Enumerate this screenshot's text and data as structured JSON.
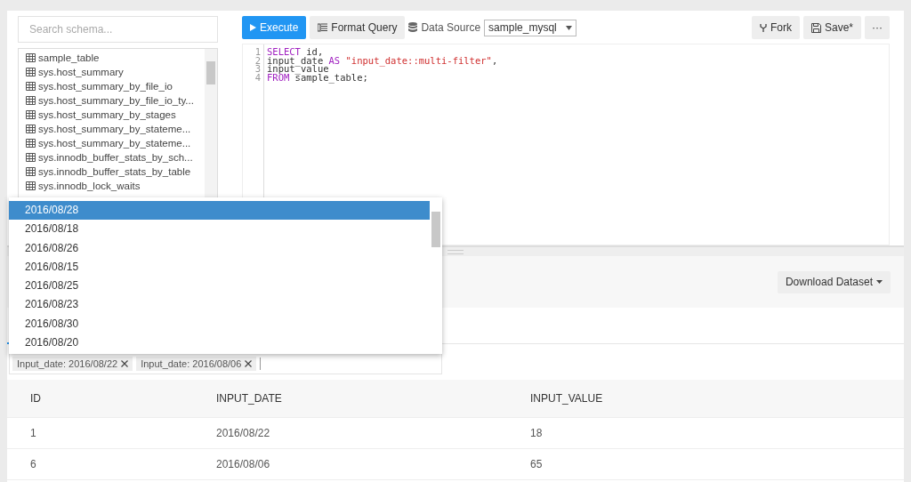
{
  "schema": {
    "search": {
      "placeholder": "Search schema..."
    },
    "tables": [
      "sample_table",
      "sys.host_summary",
      "sys.host_summary_by_file_io",
      "sys.host_summary_by_file_io_ty...",
      "sys.host_summary_by_stages",
      "sys.host_summary_by_stateme...",
      "sys.host_summary_by_stateme...",
      "sys.innodb_buffer_stats_by_sch...",
      "sys.innodb_buffer_stats_by_table",
      "sys.innodb_lock_waits"
    ]
  },
  "toolbar": {
    "execute": "Execute",
    "format": "Format Query",
    "data_source_label": "Data Source",
    "data_source": "sample_mysql",
    "fork": "Fork",
    "save": "Save*",
    "more": "···"
  },
  "editor": {
    "lines": [
      {
        "number": "1",
        "tokens": [
          {
            "kind": "keyword",
            "text": "SELECT"
          },
          {
            "kind": "plain",
            "text": " id,"
          }
        ]
      },
      {
        "number": "2",
        "tokens": [
          {
            "kind": "plain",
            "text": "input_date "
          },
          {
            "kind": "keyword",
            "text": "AS"
          },
          {
            "kind": "string",
            "text": " \"input_date::multi-filter\""
          },
          {
            "kind": "plain",
            "text": ","
          }
        ]
      },
      {
        "number": "3",
        "tokens": [
          {
            "kind": "plain",
            "text": "input_value"
          }
        ]
      },
      {
        "number": "4",
        "tokens": [
          {
            "kind": "keyword",
            "text": "FROM"
          },
          {
            "kind": "plain",
            "text": " sample_table;"
          }
        ]
      }
    ]
  },
  "results": {
    "download": "Download Dataset",
    "filter": {
      "tags": [
        "Input_date: 2016/08/22",
        "Input_date: 2016/08/06"
      ]
    },
    "dropdown": [
      {
        "label": "2016/08/28",
        "selected": true
      },
      {
        "label": "2016/08/18",
        "selected": false
      },
      {
        "label": "2016/08/26",
        "selected": false
      },
      {
        "label": "2016/08/15",
        "selected": false
      },
      {
        "label": "2016/08/25",
        "selected": false
      },
      {
        "label": "2016/08/23",
        "selected": false
      },
      {
        "label": "2016/08/30",
        "selected": false
      },
      {
        "label": "2016/08/20",
        "selected": false
      }
    ],
    "table": {
      "columns": [
        "ID",
        "INPUT_DATE",
        "INPUT_VALUE"
      ],
      "rows": [
        [
          "1",
          "2016/08/22",
          "18"
        ],
        [
          "6",
          "2016/08/06",
          "65"
        ]
      ]
    }
  }
}
